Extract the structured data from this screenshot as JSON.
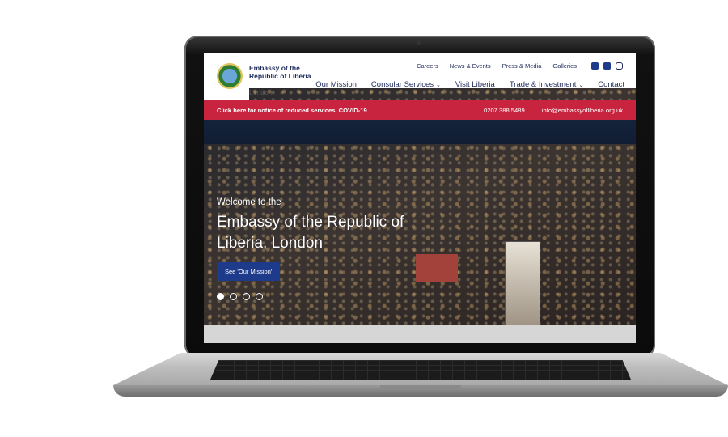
{
  "site": {
    "brand_line1": "Embassy of the",
    "brand_line2": "Republic of Liberia",
    "brand_city": "London"
  },
  "top_nav": [
    "Careers",
    "News & Events",
    "Press & Media",
    "Galleries"
  ],
  "social": [
    "facebook-icon",
    "twitter-icon",
    "instagram-icon"
  ],
  "main_nav": {
    "mission": "Our Mission",
    "consular": "Consular Services",
    "visit": "Visit Liberia",
    "trade": "Trade & Investment",
    "contact": "Contact"
  },
  "alert": {
    "notice": "Click here for notice of reduced services. COVID-19",
    "phone": "0207 388 5489",
    "email": "info@embassyofliberia.org.uk"
  },
  "hero": {
    "welcome": "Welcome to the",
    "title": "Embassy of the Republic of Liberia, London",
    "cta": "See 'Our Mission'"
  },
  "carousel": {
    "count": 4,
    "active": 1
  },
  "colors": {
    "accent_red": "#c8243f",
    "navy": "#1e3a8a"
  }
}
